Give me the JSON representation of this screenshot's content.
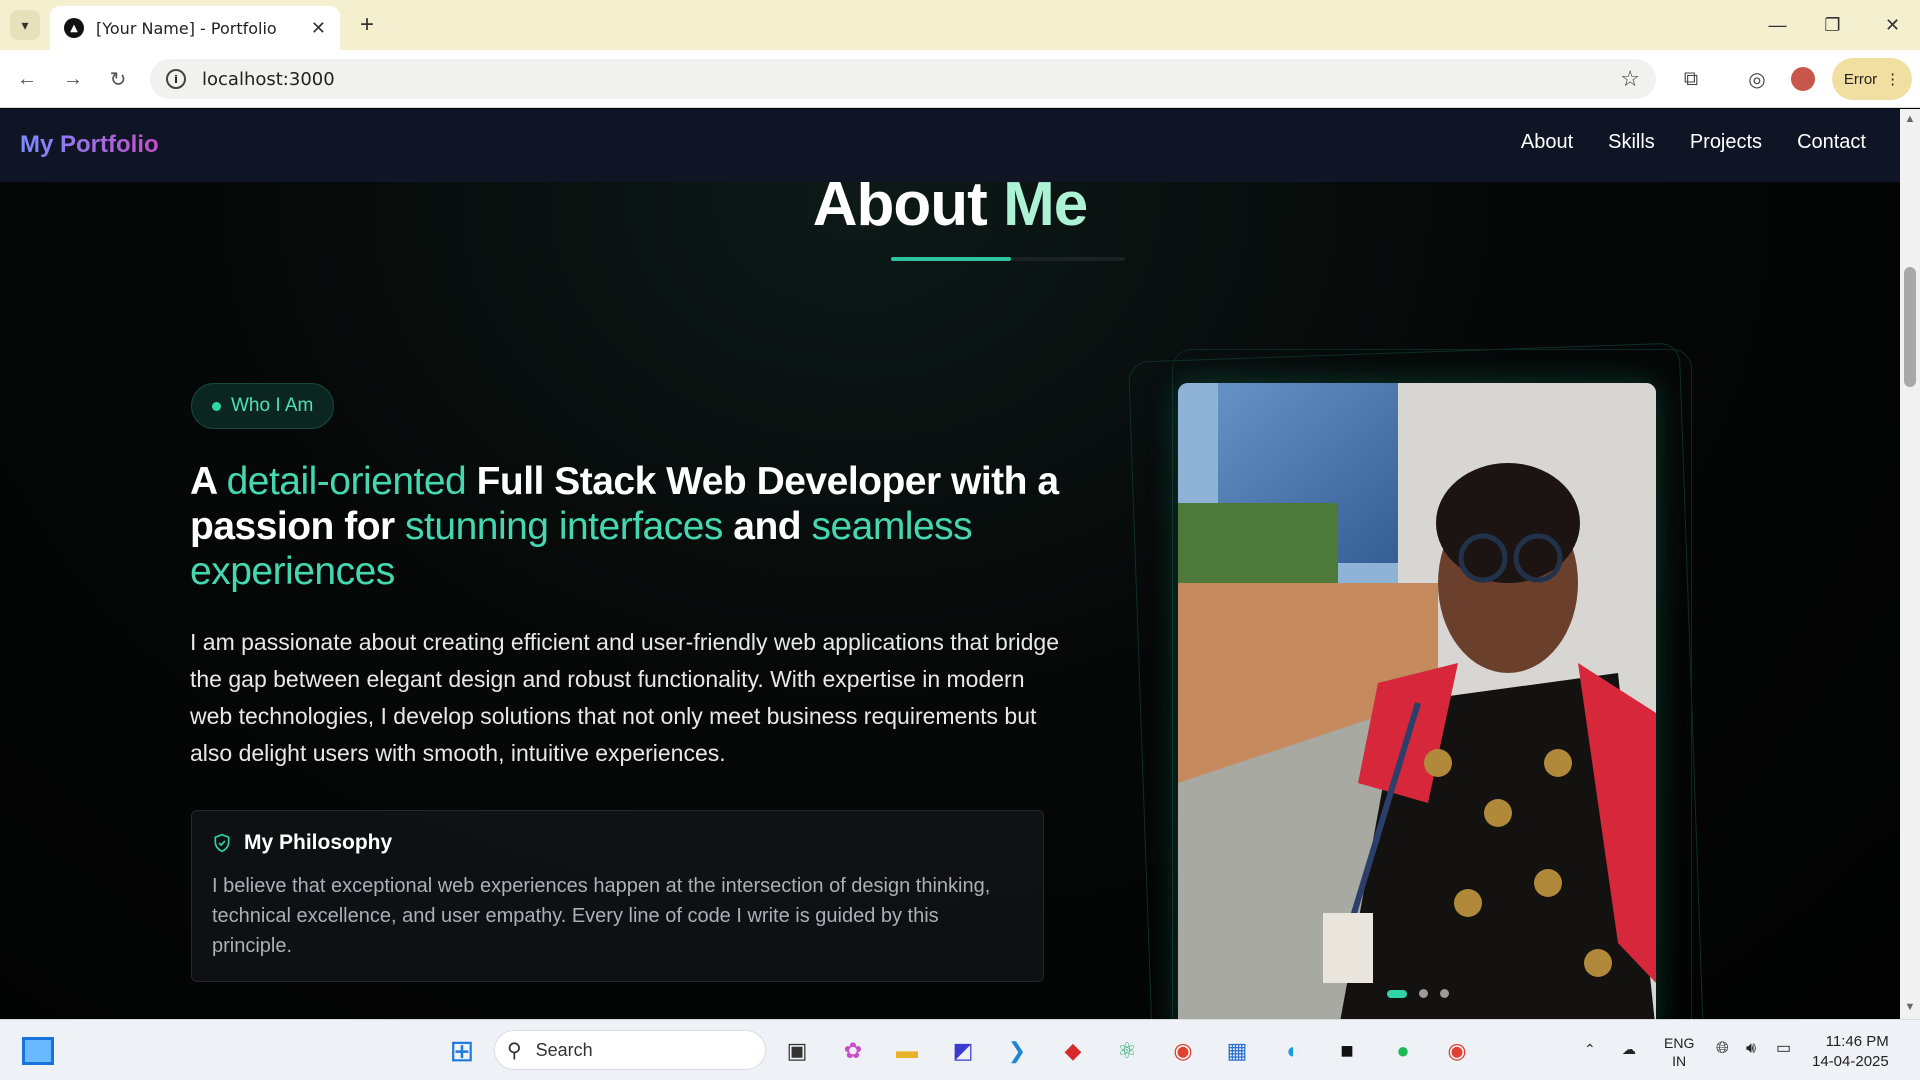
{
  "browser": {
    "tab_title": "[Your Name] - Portfolio",
    "tab_close": "✕",
    "new_tab": "+",
    "url": "localhost:3000",
    "error_label": "Error",
    "accent": "#f4efcf"
  },
  "site": {
    "brand": "My Portfolio",
    "nav": [
      "About",
      "Skills",
      "Projects",
      "Contact"
    ],
    "section_title_a": "About",
    "section_title_b": "Me",
    "pill": "Who I Am",
    "headline": {
      "p1": "A ",
      "h1": "detail-oriented",
      "p2": " Full Stack Web Developer with a passion for ",
      "h2": "stunning interfaces",
      "p3": " and ",
      "h3": "seamless experiences"
    },
    "paragraph": "I am passionate about creating efficient and user-friendly web applications that bridge the gap between elegant design and robust functionality. With expertise in modern web technologies, I develop solutions that not only meet business requirements but also delight users with smooth, intuitive experiences.",
    "philosophy_title": "My Philosophy",
    "philosophy_text": "I believe that exceptional web experiences happen at the intersection of design thinking, technical excellence, and user empathy. Every line of code I write is guided by this principle.",
    "accent_color": "#2ec4a0",
    "carousel_slides": 3,
    "carousel_active": 1
  },
  "taskbar": {
    "search_placeholder": "Search",
    "lang_top": "ENG",
    "lang_bottom": "IN",
    "time": "11:46 PM",
    "date": "14-04-2025"
  }
}
